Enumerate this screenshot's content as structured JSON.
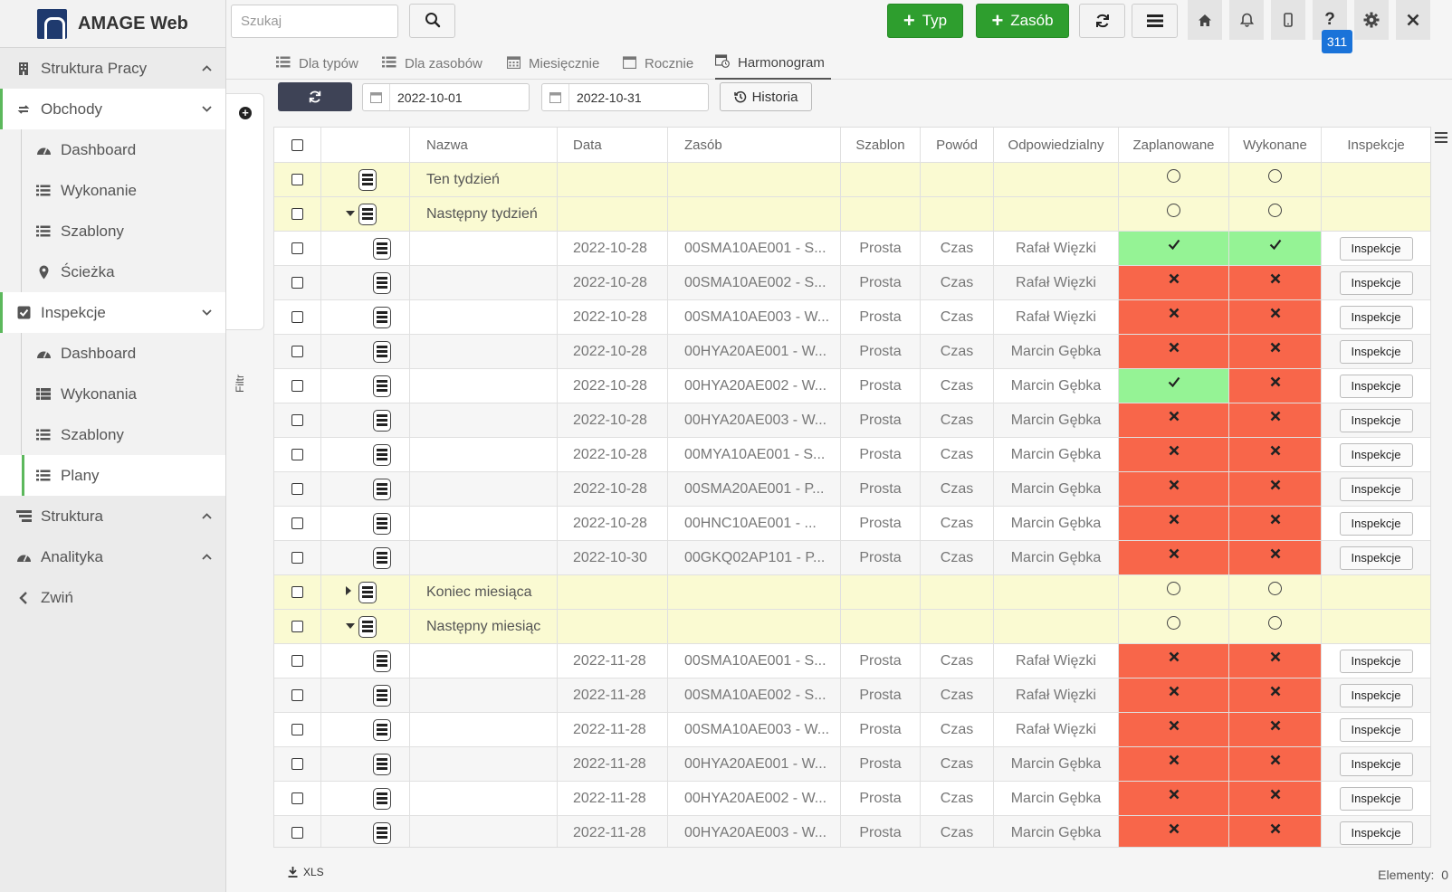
{
  "app": {
    "title": "AMAGE Web"
  },
  "search": {
    "placeholder": "Szukaj"
  },
  "toolbar": {
    "add_type": "Typ",
    "add_resource": "Zasób",
    "badge": "311"
  },
  "sidebar": {
    "items": [
      {
        "label": "Struktura Pracy",
        "kind": "sec",
        "icon": "building-icon",
        "chev": "up"
      },
      {
        "label": "Obchody",
        "kind": "sec",
        "icon": "cycle-icon",
        "chev": "down",
        "active": true
      },
      {
        "label": "Dashboard",
        "kind": "sub",
        "icon": "gauge-icon"
      },
      {
        "label": "Wykonanie",
        "kind": "sub",
        "icon": "list-icon"
      },
      {
        "label": "Szablony",
        "kind": "sub",
        "icon": "list-icon"
      },
      {
        "label": "Ścieżka",
        "kind": "sub",
        "icon": "pin-icon"
      },
      {
        "label": "Inspekcje",
        "kind": "sec",
        "icon": "checkbox-icon",
        "chev": "down",
        "active": true
      },
      {
        "label": "Dashboard",
        "kind": "sub",
        "icon": "gauge-icon"
      },
      {
        "label": "Wykonania",
        "kind": "sub",
        "icon": "table-list-icon"
      },
      {
        "label": "Szablony",
        "kind": "sub",
        "icon": "list-icon"
      },
      {
        "label": "Plany",
        "kind": "sub",
        "icon": "list-icon",
        "selected": true
      },
      {
        "label": "Struktura",
        "kind": "sec",
        "icon": "tree-icon",
        "chev": "up"
      },
      {
        "label": "Analityka",
        "kind": "sec",
        "icon": "gauge-icon",
        "chev": "up"
      },
      {
        "label": "Zwiń",
        "kind": "sec",
        "icon": "chevron-left-icon"
      }
    ]
  },
  "filter": {
    "label": "Filtr"
  },
  "tabs": [
    {
      "label": "Dla typów",
      "icon": "list-icon"
    },
    {
      "label": "Dla zasobów",
      "icon": "list-icon"
    },
    {
      "label": "Miesięcznie",
      "icon": "calendar-grid-icon"
    },
    {
      "label": "Rocznie",
      "icon": "calendar-icon"
    },
    {
      "label": "Harmonogram",
      "icon": "calendar-clock-icon",
      "active": true
    }
  ],
  "controls": {
    "date_from": "2022-10-01",
    "date_to": "2022-10-31",
    "history": "Historia"
  },
  "grid": {
    "columns": [
      "Nazwa",
      "Data",
      "Zasób",
      "Szablon",
      "Powód",
      "Odpowiedzialny",
      "Zaplanowane",
      "Wykonane",
      "Inspekcje"
    ],
    "inspect_label": "Inspekcje",
    "rows": [
      {
        "type": "group",
        "name": "Ten tydzień",
        "expand": "none"
      },
      {
        "type": "group",
        "name": "Następny tydzień",
        "expand": "open"
      },
      {
        "type": "item",
        "date": "2022-10-28",
        "resource": "00SMA10AE001 - S...",
        "template": "Prosta",
        "reason": "Czas",
        "owner": "Rafał Więzki",
        "planned": "ok",
        "done": "ok"
      },
      {
        "type": "item",
        "date": "2022-10-28",
        "resource": "00SMA10AE002 - S...",
        "template": "Prosta",
        "reason": "Czas",
        "owner": "Rafał Więzki",
        "planned": "bad",
        "done": "bad"
      },
      {
        "type": "item",
        "date": "2022-10-28",
        "resource": "00SMA10AE003 - W...",
        "template": "Prosta",
        "reason": "Czas",
        "owner": "Rafał Więzki",
        "planned": "bad",
        "done": "bad"
      },
      {
        "type": "item",
        "date": "2022-10-28",
        "resource": "00HYA20AE001 - W...",
        "template": "Prosta",
        "reason": "Czas",
        "owner": "Marcin Gębka",
        "planned": "bad",
        "done": "bad"
      },
      {
        "type": "item",
        "date": "2022-10-28",
        "resource": "00HYA20AE002 - W...",
        "template": "Prosta",
        "reason": "Czas",
        "owner": "Marcin Gębka",
        "planned": "ok",
        "done": "bad"
      },
      {
        "type": "item",
        "date": "2022-10-28",
        "resource": "00HYA20AE003 - W...",
        "template": "Prosta",
        "reason": "Czas",
        "owner": "Marcin Gębka",
        "planned": "bad",
        "done": "bad"
      },
      {
        "type": "item",
        "date": "2022-10-28",
        "resource": "00MYA10AE001 - S...",
        "template": "Prosta",
        "reason": "Czas",
        "owner": "Marcin Gębka",
        "planned": "bad",
        "done": "bad"
      },
      {
        "type": "item",
        "date": "2022-10-28",
        "resource": "00SMA20AE001 - P...",
        "template": "Prosta",
        "reason": "Czas",
        "owner": "Marcin Gębka",
        "planned": "bad",
        "done": "bad"
      },
      {
        "type": "item",
        "date": "2022-10-28",
        "resource": "00HNC10AE001 - ...",
        "template": "Prosta",
        "reason": "Czas",
        "owner": "Marcin Gębka",
        "planned": "bad",
        "done": "bad"
      },
      {
        "type": "item",
        "date": "2022-10-30",
        "resource": "00GKQ02AP101 - P...",
        "template": "Prosta",
        "reason": "Czas",
        "owner": "Marcin Gębka",
        "planned": "bad",
        "done": "bad"
      },
      {
        "type": "group",
        "name": "Koniec miesiąca",
        "expand": "closed"
      },
      {
        "type": "group",
        "name": "Następny miesiąc",
        "expand": "open"
      },
      {
        "type": "item",
        "date": "2022-11-28",
        "resource": "00SMA10AE001 - S...",
        "template": "Prosta",
        "reason": "Czas",
        "owner": "Rafał Więzki",
        "planned": "bad",
        "done": "bad"
      },
      {
        "type": "item",
        "date": "2022-11-28",
        "resource": "00SMA10AE002 - S...",
        "template": "Prosta",
        "reason": "Czas",
        "owner": "Rafał Więzki",
        "planned": "bad",
        "done": "bad"
      },
      {
        "type": "item",
        "date": "2022-11-28",
        "resource": "00SMA10AE003 - W...",
        "template": "Prosta",
        "reason": "Czas",
        "owner": "Rafał Więzki",
        "planned": "bad",
        "done": "bad"
      },
      {
        "type": "item",
        "date": "2022-11-28",
        "resource": "00HYA20AE001 - W...",
        "template": "Prosta",
        "reason": "Czas",
        "owner": "Marcin Gębka",
        "planned": "bad",
        "done": "bad"
      },
      {
        "type": "item",
        "date": "2022-11-28",
        "resource": "00HYA20AE002 - W...",
        "template": "Prosta",
        "reason": "Czas",
        "owner": "Marcin Gębka",
        "planned": "bad",
        "done": "bad"
      },
      {
        "type": "item",
        "date": "2022-11-28",
        "resource": "00HYA20AE003 - W...",
        "template": "Prosta",
        "reason": "Czas",
        "owner": "Marcin Gębka",
        "planned": "bad",
        "done": "bad"
      }
    ]
  },
  "footer": {
    "export": "XLS",
    "count_label": "Elementy:",
    "count": "0"
  },
  "colors": {
    "ok": "#95f395",
    "bad": "#f8664a",
    "group": "#fafad2",
    "accent": "#5cb85c",
    "primary": "#2e9e2e",
    "badge": "#1a73d9"
  }
}
